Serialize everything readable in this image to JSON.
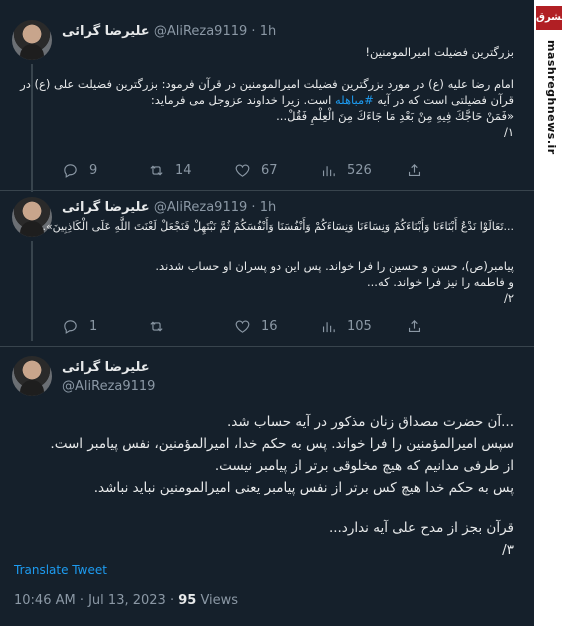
{
  "tweets": [
    {
      "name": "علیرضا گرائی",
      "handle": "@AliReza9119",
      "sep": "·",
      "time": "1h",
      "lines": [
        "بزرگترین فضیلت امیرالمومنین!",
        "",
        "امام رضا علیه (ع) در مورد بزرگترین فضیلت امیرالمومنین در قرآن فرمود: بزرگترین فضیلت علی (ع) در",
        "قرآن فضیلتی است که در آیه #مباهله است. زیرا خداوند عزوجل می فرماید:",
        "«فَمَنْ حَاجَّكَ فِيهِ مِنْ بَعْدِ مَا جَاءَكَ مِنَ الْعِلْمِ فَقُلْ...",
        "۱/"
      ],
      "replies": "9",
      "retweets": "14",
      "likes": "67",
      "views": "526"
    },
    {
      "name": "علیرضا گرائی",
      "handle": "@AliReza9119",
      "sep": "·",
      "time": "1h",
      "lines": [
        "...تَعَالَوْا نَدْعُ أَبْنَاءَنَا وَأَبْنَاءَكُمْ وَنِسَاءَنَا وَنِسَاءَكُمْ وَأَنْفُسَنَا وَأَنْفُسَكُمْ ثُمَّ نَبْتَهِلْ فَنَجْعَلْ لَعْنَتَ اللَّهِ عَلَى الْكَاذِبِينَ».",
        "",
        "پیامبر(ص)، حسن و حسین را فرا خواند. پس این دو پسران او حساب شدند.",
        "و فاطمه را نیز فرا خواند. که...",
        "۲/"
      ],
      "replies": "1",
      "retweets": "",
      "likes": "16",
      "views": "105"
    }
  ],
  "main": {
    "name": "علیرضا گرائی",
    "handle": "@AliReza9119",
    "lines": [
      "...آن حضرت مصداق زنان مذکور در آیه حساب شد.",
      "سپس امیرالمؤمنین را فرا خواند. پس به حکم خدا، امیرالمؤمنین، نفس پیامبر است.",
      "از طرفی مدانیم که هیچ مخلوقی برتر از پیامبر نیست.",
      "پس به حکم خدا هیچ کس برتر از نفس پیامبر یعنی امیرالمومنین نباید نباشد.",
      "",
      "قرآن بجز از مدح علی آیه ندارد...",
      "۳/"
    ],
    "translate": "Translate Tweet",
    "timestamp": "10:46 AM · Jul 13, 2023 · ",
    "views_count": "95",
    "views_label": " Views"
  },
  "watermark": {
    "logo": "مشرق",
    "site": "mashreghnews.ir"
  }
}
